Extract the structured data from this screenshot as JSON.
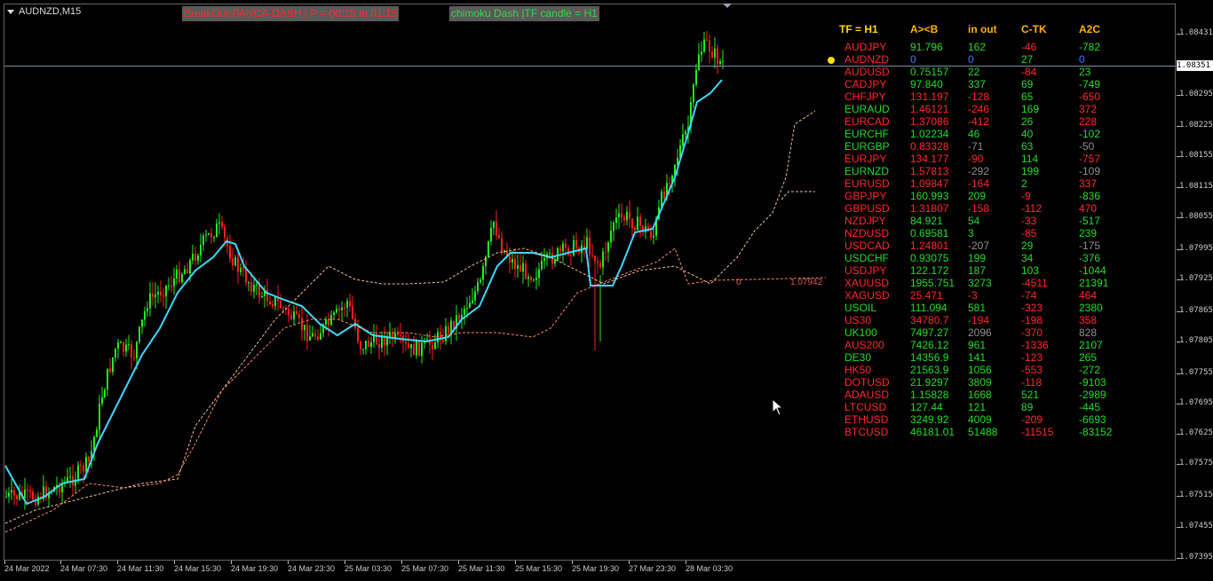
{
  "window": {
    "symbol_title": "AUDNZD,M15",
    "breakout_banner": "BreakOut-PANCA-DASH | P = 00:15 to 01:15",
    "ichimoku_banner": "chimoku Dash |TF candle = H1",
    "current_price": "1.08351"
  },
  "price_axis": {
    "labels": [
      "1.08431",
      "1.08351",
      "1.08295",
      "1.08225",
      "1.08155",
      "1.08115",
      "1.08055",
      "1.07995",
      "1.07925",
      "1.07865",
      "1.07805",
      "1.07755",
      "1.07695",
      "1.07625",
      "1.07575",
      "1.07515",
      "1.07455",
      "1.07395"
    ],
    "label_positions": [
      38,
      74,
      107,
      142,
      176,
      211,
      245,
      281,
      315,
      351,
      385,
      421,
      455,
      489,
      523,
      559,
      594,
      629
    ]
  },
  "time_axis": {
    "labels": [
      "24 Mar 2022",
      "24 Mar 07:30",
      "24 Mar 11:30",
      "24 Mar 15:30",
      "24 Mar 19:30",
      "24 Mar 23:30",
      "25 Mar 03:30",
      "25 Mar 07:30",
      "25 Mar 11:30",
      "25 Mar 15:30",
      "25 Mar 19:30",
      "27 Mar 23:30",
      "28 Mar 03:30"
    ]
  },
  "ichimoku_labels": {
    "zero": "0",
    "kijun_value": "1.07942"
  },
  "colors": {
    "bull": "#22ee22",
    "bear": "#ff2020",
    "tenkan": "#40d8ff",
    "senkou_a": "#f0c090",
    "senkou_b": "#ff8860",
    "header": "#ffb000",
    "header_tf": "#ffd700",
    "pos": "#22dd22",
    "neg": "#ff2a2a",
    "neutral": "#909090",
    "zero": "#3a7bff"
  },
  "dashboard": {
    "headers": [
      "TF = H1",
      "A><B",
      "in out",
      "C-TK",
      "A2C"
    ],
    "rows": [
      {
        "sym": "AUDJPY",
        "v": [
          "91.796",
          "162",
          "-46",
          "-782"
        ],
        "c": [
          "neg",
          "pos",
          "pos",
          "neg",
          "pos"
        ]
      },
      {
        "sym": "AUDNZD",
        "v": [
          "0",
          "0",
          "27",
          "0"
        ],
        "c": [
          "neg",
          "zero",
          "zero",
          "pos",
          "zero"
        ]
      },
      {
        "sym": "AUDUSD",
        "v": [
          "0.75157",
          "22",
          "-84",
          "23"
        ],
        "c": [
          "neg",
          "pos",
          "pos",
          "neg",
          "pos"
        ]
      },
      {
        "sym": "CADJPY",
        "v": [
          "97.840",
          "337",
          "69",
          "-749"
        ],
        "c": [
          "neg",
          "pos",
          "pos",
          "pos",
          "pos"
        ]
      },
      {
        "sym": "CHFJPY",
        "v": [
          "131.197",
          "-128",
          "65",
          "-650"
        ],
        "c": [
          "neg",
          "neg",
          "neg",
          "pos",
          "neg"
        ]
      },
      {
        "sym": "EURAUD",
        "v": [
          "1.46121",
          "-246",
          "169",
          "372"
        ],
        "c": [
          "pos",
          "neg",
          "neg",
          "pos",
          "neg"
        ]
      },
      {
        "sym": "EURCAD",
        "v": [
          "1.37086",
          "-412",
          "26",
          "228"
        ],
        "c": [
          "neg",
          "neg",
          "neg",
          "pos",
          "neg"
        ]
      },
      {
        "sym": "EURCHF",
        "v": [
          "1.02234",
          "46",
          "40",
          "-102"
        ],
        "c": [
          "pos",
          "pos",
          "pos",
          "pos",
          "pos"
        ]
      },
      {
        "sym": "EURGBP",
        "v": [
          "0.83328",
          "-71",
          "63",
          "-50"
        ],
        "c": [
          "pos",
          "neg",
          "neutral",
          "pos",
          "neutral"
        ]
      },
      {
        "sym": "EURJPY",
        "v": [
          "134.177",
          "-90",
          "114",
          "-757"
        ],
        "c": [
          "neg",
          "neg",
          "neg",
          "pos",
          "neg"
        ]
      },
      {
        "sym": "EURNZD",
        "v": [
          "1.57813",
          "-292",
          "199",
          "-109"
        ],
        "c": [
          "pos",
          "neg",
          "neutral",
          "pos",
          "neutral"
        ]
      },
      {
        "sym": "EURUSD",
        "v": [
          "1.09847",
          "-164",
          "2",
          "337"
        ],
        "c": [
          "neg",
          "neg",
          "neg",
          "pos",
          "neg"
        ]
      },
      {
        "sym": "GBPJPY",
        "v": [
          "160.993",
          "209",
          "-9",
          "-836"
        ],
        "c": [
          "neg",
          "pos",
          "pos",
          "neg",
          "pos"
        ]
      },
      {
        "sym": "GBPUSD",
        "v": [
          "1.31807",
          "-158",
          "-112",
          "470"
        ],
        "c": [
          "neg",
          "neg",
          "neg",
          "neg",
          "neg"
        ]
      },
      {
        "sym": "NZDJPY",
        "v": [
          "84.921",
          "54",
          "-33",
          "-517"
        ],
        "c": [
          "neg",
          "pos",
          "pos",
          "neg",
          "pos"
        ]
      },
      {
        "sym": "NZDUSD",
        "v": [
          "0.69581",
          "3",
          "-85",
          "239"
        ],
        "c": [
          "neg",
          "pos",
          "pos",
          "neg",
          "pos"
        ]
      },
      {
        "sym": "USDCAD",
        "v": [
          "1.24801",
          "-207",
          "29",
          "-175"
        ],
        "c": [
          "neg",
          "neg",
          "neutral",
          "pos",
          "neutral"
        ]
      },
      {
        "sym": "USDCHF",
        "v": [
          "0.93075",
          "199",
          "34",
          "-376"
        ],
        "c": [
          "pos",
          "pos",
          "pos",
          "pos",
          "pos"
        ]
      },
      {
        "sym": "USDJPY",
        "v": [
          "122.172",
          "187",
          "103",
          "-1044"
        ],
        "c": [
          "neg",
          "pos",
          "pos",
          "pos",
          "pos"
        ]
      },
      {
        "sym": "XAUUSD",
        "v": [
          "1955.751",
          "3273",
          "-4511",
          "21391"
        ],
        "c": [
          "neg",
          "pos",
          "pos",
          "neg",
          "pos"
        ]
      },
      {
        "sym": "XAGUSD",
        "v": [
          "25.471",
          "-3",
          "-74",
          "464"
        ],
        "c": [
          "neg",
          "neg",
          "neg",
          "neg",
          "neg"
        ]
      },
      {
        "sym": "USOIL",
        "v": [
          "111.094",
          "581",
          "-323",
          "2380"
        ],
        "c": [
          "pos",
          "pos",
          "pos",
          "neg",
          "pos"
        ]
      },
      {
        "sym": "US30",
        "v": [
          "34780.7",
          "-194",
          "-198",
          "358"
        ],
        "c": [
          "neg",
          "neg",
          "neg",
          "neg",
          "neg"
        ]
      },
      {
        "sym": "UK100",
        "v": [
          "7497.27",
          "2096",
          "-370",
          "828"
        ],
        "c": [
          "pos",
          "pos",
          "neutral",
          "neg",
          "neutral"
        ]
      },
      {
        "sym": "AUS200",
        "v": [
          "7426.12",
          "961",
          "-1336",
          "2107"
        ],
        "c": [
          "neg",
          "pos",
          "pos",
          "neg",
          "pos"
        ]
      },
      {
        "sym": "DE30",
        "v": [
          "14356.9",
          "141",
          "-123",
          "265"
        ],
        "c": [
          "pos",
          "pos",
          "pos",
          "neg",
          "pos"
        ]
      },
      {
        "sym": "HK50",
        "v": [
          "21563.9",
          "1056",
          "-553",
          "-272"
        ],
        "c": [
          "neg",
          "pos",
          "pos",
          "neg",
          "pos"
        ]
      },
      {
        "sym": "DOTUSD",
        "v": [
          "21.9297",
          "3809",
          "-118",
          "-9103"
        ],
        "c": [
          "neg",
          "pos",
          "pos",
          "neg",
          "pos"
        ]
      },
      {
        "sym": "ADAUSD",
        "v": [
          "1.15828",
          "1668",
          "521",
          "-2989"
        ],
        "c": [
          "neg",
          "pos",
          "pos",
          "pos",
          "pos"
        ]
      },
      {
        "sym": "LTCUSD",
        "v": [
          "127.44",
          "121",
          "89",
          "-445"
        ],
        "c": [
          "neg",
          "pos",
          "pos",
          "pos",
          "pos"
        ]
      },
      {
        "sym": "ETHUSD",
        "v": [
          "3249.92",
          "4009",
          "-209",
          "-6693"
        ],
        "c": [
          "neg",
          "pos",
          "pos",
          "neg",
          "pos"
        ]
      },
      {
        "sym": "BTCUSD",
        "v": [
          "46181.01",
          "51488",
          "-11515",
          "-83152"
        ],
        "c": [
          "neg",
          "pos",
          "pos",
          "neg",
          "pos"
        ]
      }
    ]
  }
}
